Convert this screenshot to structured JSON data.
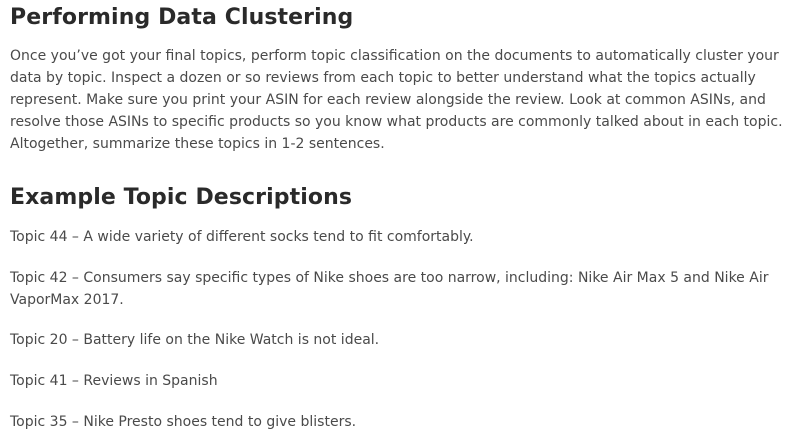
{
  "sections": {
    "clustering": {
      "heading": "Performing Data Clustering",
      "body": "Once you’ve got your final topics, perform topic classification on the documents to automatically cluster your data by topic. Inspect a dozen or so reviews from each topic to better understand what the topics actually represent. Make sure you print your ASIN for each review alongside the review. Look at common ASINs, and resolve those ASINs to specific products so you know what products are commonly talked about in each topic. Altogether, summarize these topics in 1-2 sentences."
    },
    "examples": {
      "heading": "Example Topic Descriptions",
      "topics": [
        "Topic 44 – A wide variety of different socks tend to fit comfortably.",
        "Topic 42 – Consumers say specific types of Nike shoes are too narrow, including: Nike Air Max 5 and Nike Air VaporMax 2017.",
        "Topic 20 – Battery life on the Nike Watch is not ideal.",
        "Topic 41 – Reviews in Spanish",
        "Topic 35 – Nike Presto shoes tend to give blisters."
      ]
    }
  }
}
